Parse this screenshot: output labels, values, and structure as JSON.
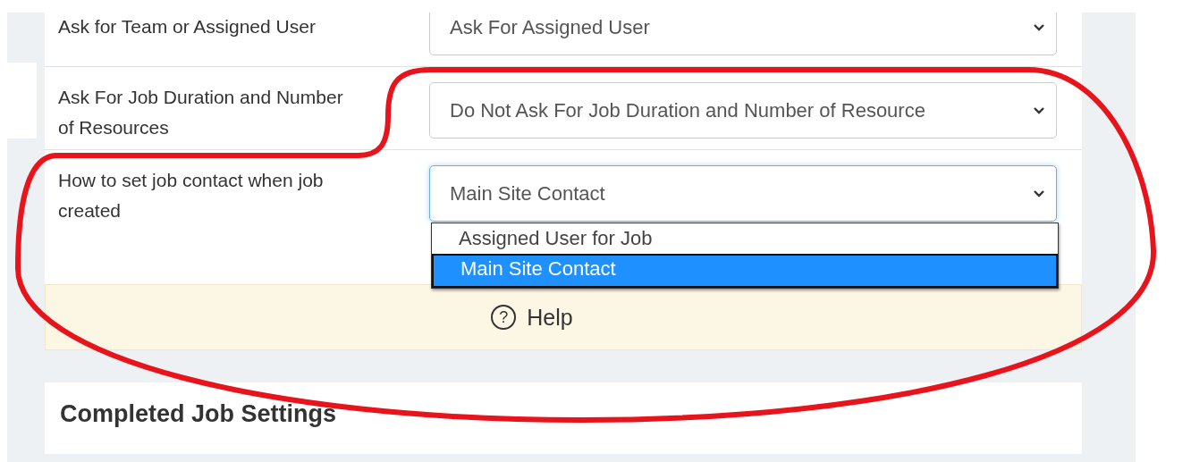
{
  "settings": [
    {
      "label": "Ask for Team or Assigned User",
      "value": "Ask For Assigned User",
      "focused": false
    },
    {
      "label": "Ask For Job Duration and Number of Resources",
      "value": "Do Not Ask For Job Duration and Number of Resource",
      "focused": false
    },
    {
      "label": "How to set job contact when job created",
      "value": "Main Site Contact",
      "focused": true,
      "options": [
        {
          "label": "Assigned User for Job",
          "selected": false
        },
        {
          "label": "Main Site Contact",
          "selected": true
        }
      ]
    }
  ],
  "help": {
    "icon": "?",
    "label": "Help"
  },
  "next_section": {
    "title": "Completed Job Settings"
  },
  "annotation": {
    "kind": "ellipse"
  }
}
